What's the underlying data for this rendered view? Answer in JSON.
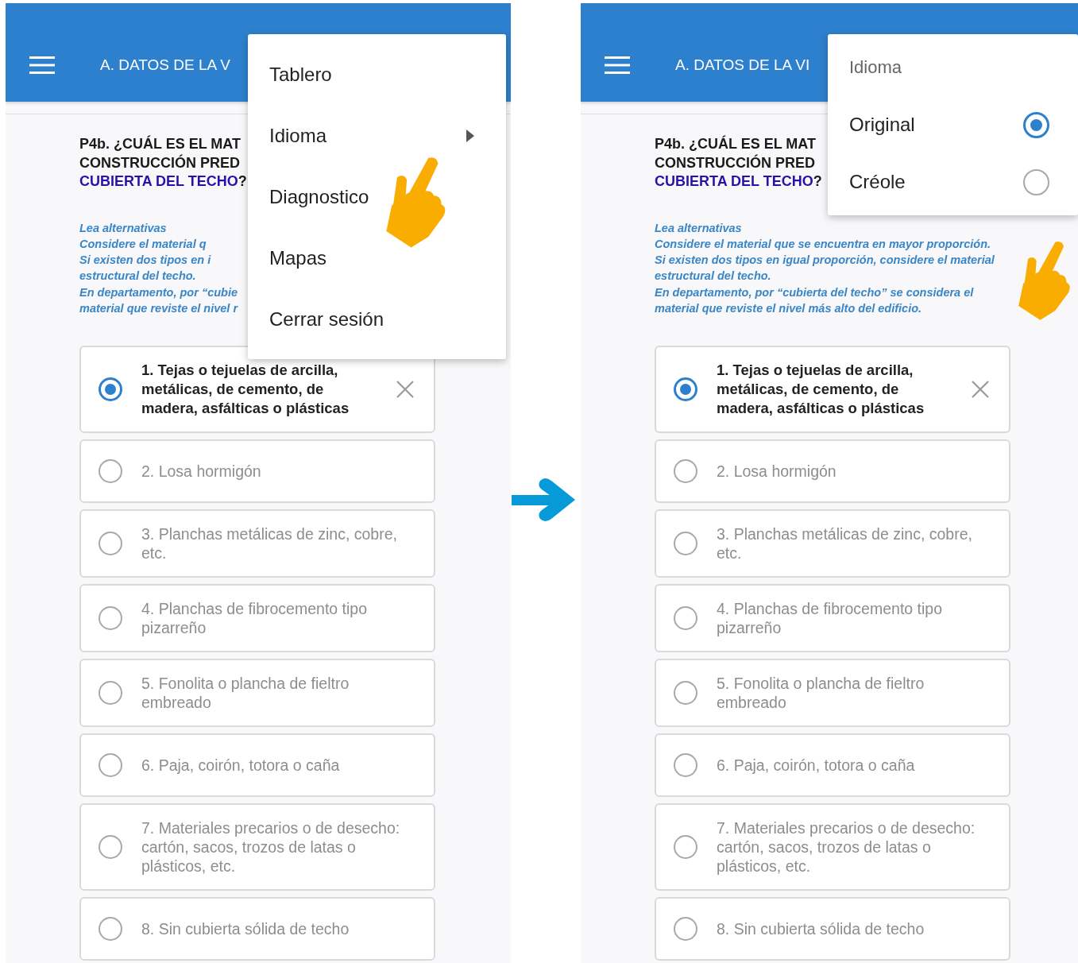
{
  "panels": [
    {
      "header": {
        "title": "A. DATOS DE LA V"
      },
      "question": [
        [
          {
            "text": "P4b. ¿CUÁL ES EL MAT",
            "kind": "plain"
          }
        ],
        [
          {
            "text": "CONSTRUCCIÓN PRED",
            "kind": "plain"
          }
        ],
        [
          {
            "text": "CUBIERTA DEL TECHO",
            "kind": "highlight"
          },
          {
            "text": "?",
            "kind": "plain"
          }
        ]
      ],
      "instructions": [
        "Lea alternativas",
        "Considere el material q",
        "Si existen dos tipos en i",
        "estructural del techo.",
        "En departamento, por “cubie",
        "material que reviste el nivel r"
      ],
      "options": [
        {
          "label": "1. Tejas o tejuelas de arcilla, metálicas, de cemento, de madera, asfálticas o plásticas",
          "selected": true
        },
        {
          "label": "2. Losa hormigón",
          "selected": false
        },
        {
          "label": "3. Planchas metálicas de zinc, cobre, etc.",
          "selected": false
        },
        {
          "label": "4. Planchas de fibrocemento tipo pizarreño",
          "selected": false
        },
        {
          "label": "5. Fonolita o plancha de fieltro embreado",
          "selected": false
        },
        {
          "label": "6. Paja, coirón, totora o caña",
          "selected": false
        },
        {
          "label": "7. Materiales precarios o de desecho: cartón, sacos, trozos de latas o plásticos, etc.",
          "selected": false
        },
        {
          "label": "8. Sin cubierta sólida de techo",
          "selected": false
        }
      ],
      "menu": {
        "kind": "actions",
        "items": [
          {
            "label": "Tablero",
            "submenu": false
          },
          {
            "label": "Idioma",
            "submenu": true
          },
          {
            "label": "Diagnostico",
            "submenu": false
          },
          {
            "label": "Mapas",
            "submenu": false
          },
          {
            "label": "Cerrar sesión",
            "submenu": false
          }
        ]
      }
    },
    {
      "header": {
        "title": "A. DATOS DE LA VI"
      },
      "question": [
        [
          {
            "text": "P4b. ¿CUÁL ES EL MAT",
            "kind": "plain"
          }
        ],
        [
          {
            "text": "CONSTRUCCIÓN PRED",
            "kind": "plain"
          }
        ],
        [
          {
            "text": "CUBIERTA DEL TECHO",
            "kind": "highlight"
          },
          {
            "text": "?",
            "kind": "plain"
          }
        ]
      ],
      "instructions": [
        "Lea alternativas",
        "Considere el material que se encuentra en mayor proporción.",
        "Si existen dos tipos en igual proporción, considere el material",
        "estructural del techo.",
        "En departamento, por “cubierta del techo” se considera el",
        "material que reviste el nivel más alto del edificio."
      ],
      "options": [
        {
          "label": "1. Tejas o tejuelas de arcilla, metálicas, de cemento, de madera, asfálticas o plásticas",
          "selected": true
        },
        {
          "label": "2. Losa hormigón",
          "selected": false
        },
        {
          "label": "3. Planchas metálicas de zinc, cobre, etc.",
          "selected": false
        },
        {
          "label": "4. Planchas de fibrocemento tipo pizarreño",
          "selected": false
        },
        {
          "label": "5. Fonolita o plancha de fieltro embreado",
          "selected": false
        },
        {
          "label": "6. Paja, coirón, totora o caña",
          "selected": false
        },
        {
          "label": "7. Materiales precarios o de desecho: cartón, sacos, trozos de latas o plásticos, etc.",
          "selected": false
        },
        {
          "label": "8. Sin cubierta sólida de techo",
          "selected": false
        }
      ],
      "menu": {
        "kind": "language",
        "title": "Idioma",
        "items": [
          {
            "label": "Original",
            "selected": true
          },
          {
            "label": "Créole",
            "selected": false
          }
        ]
      }
    }
  ]
}
